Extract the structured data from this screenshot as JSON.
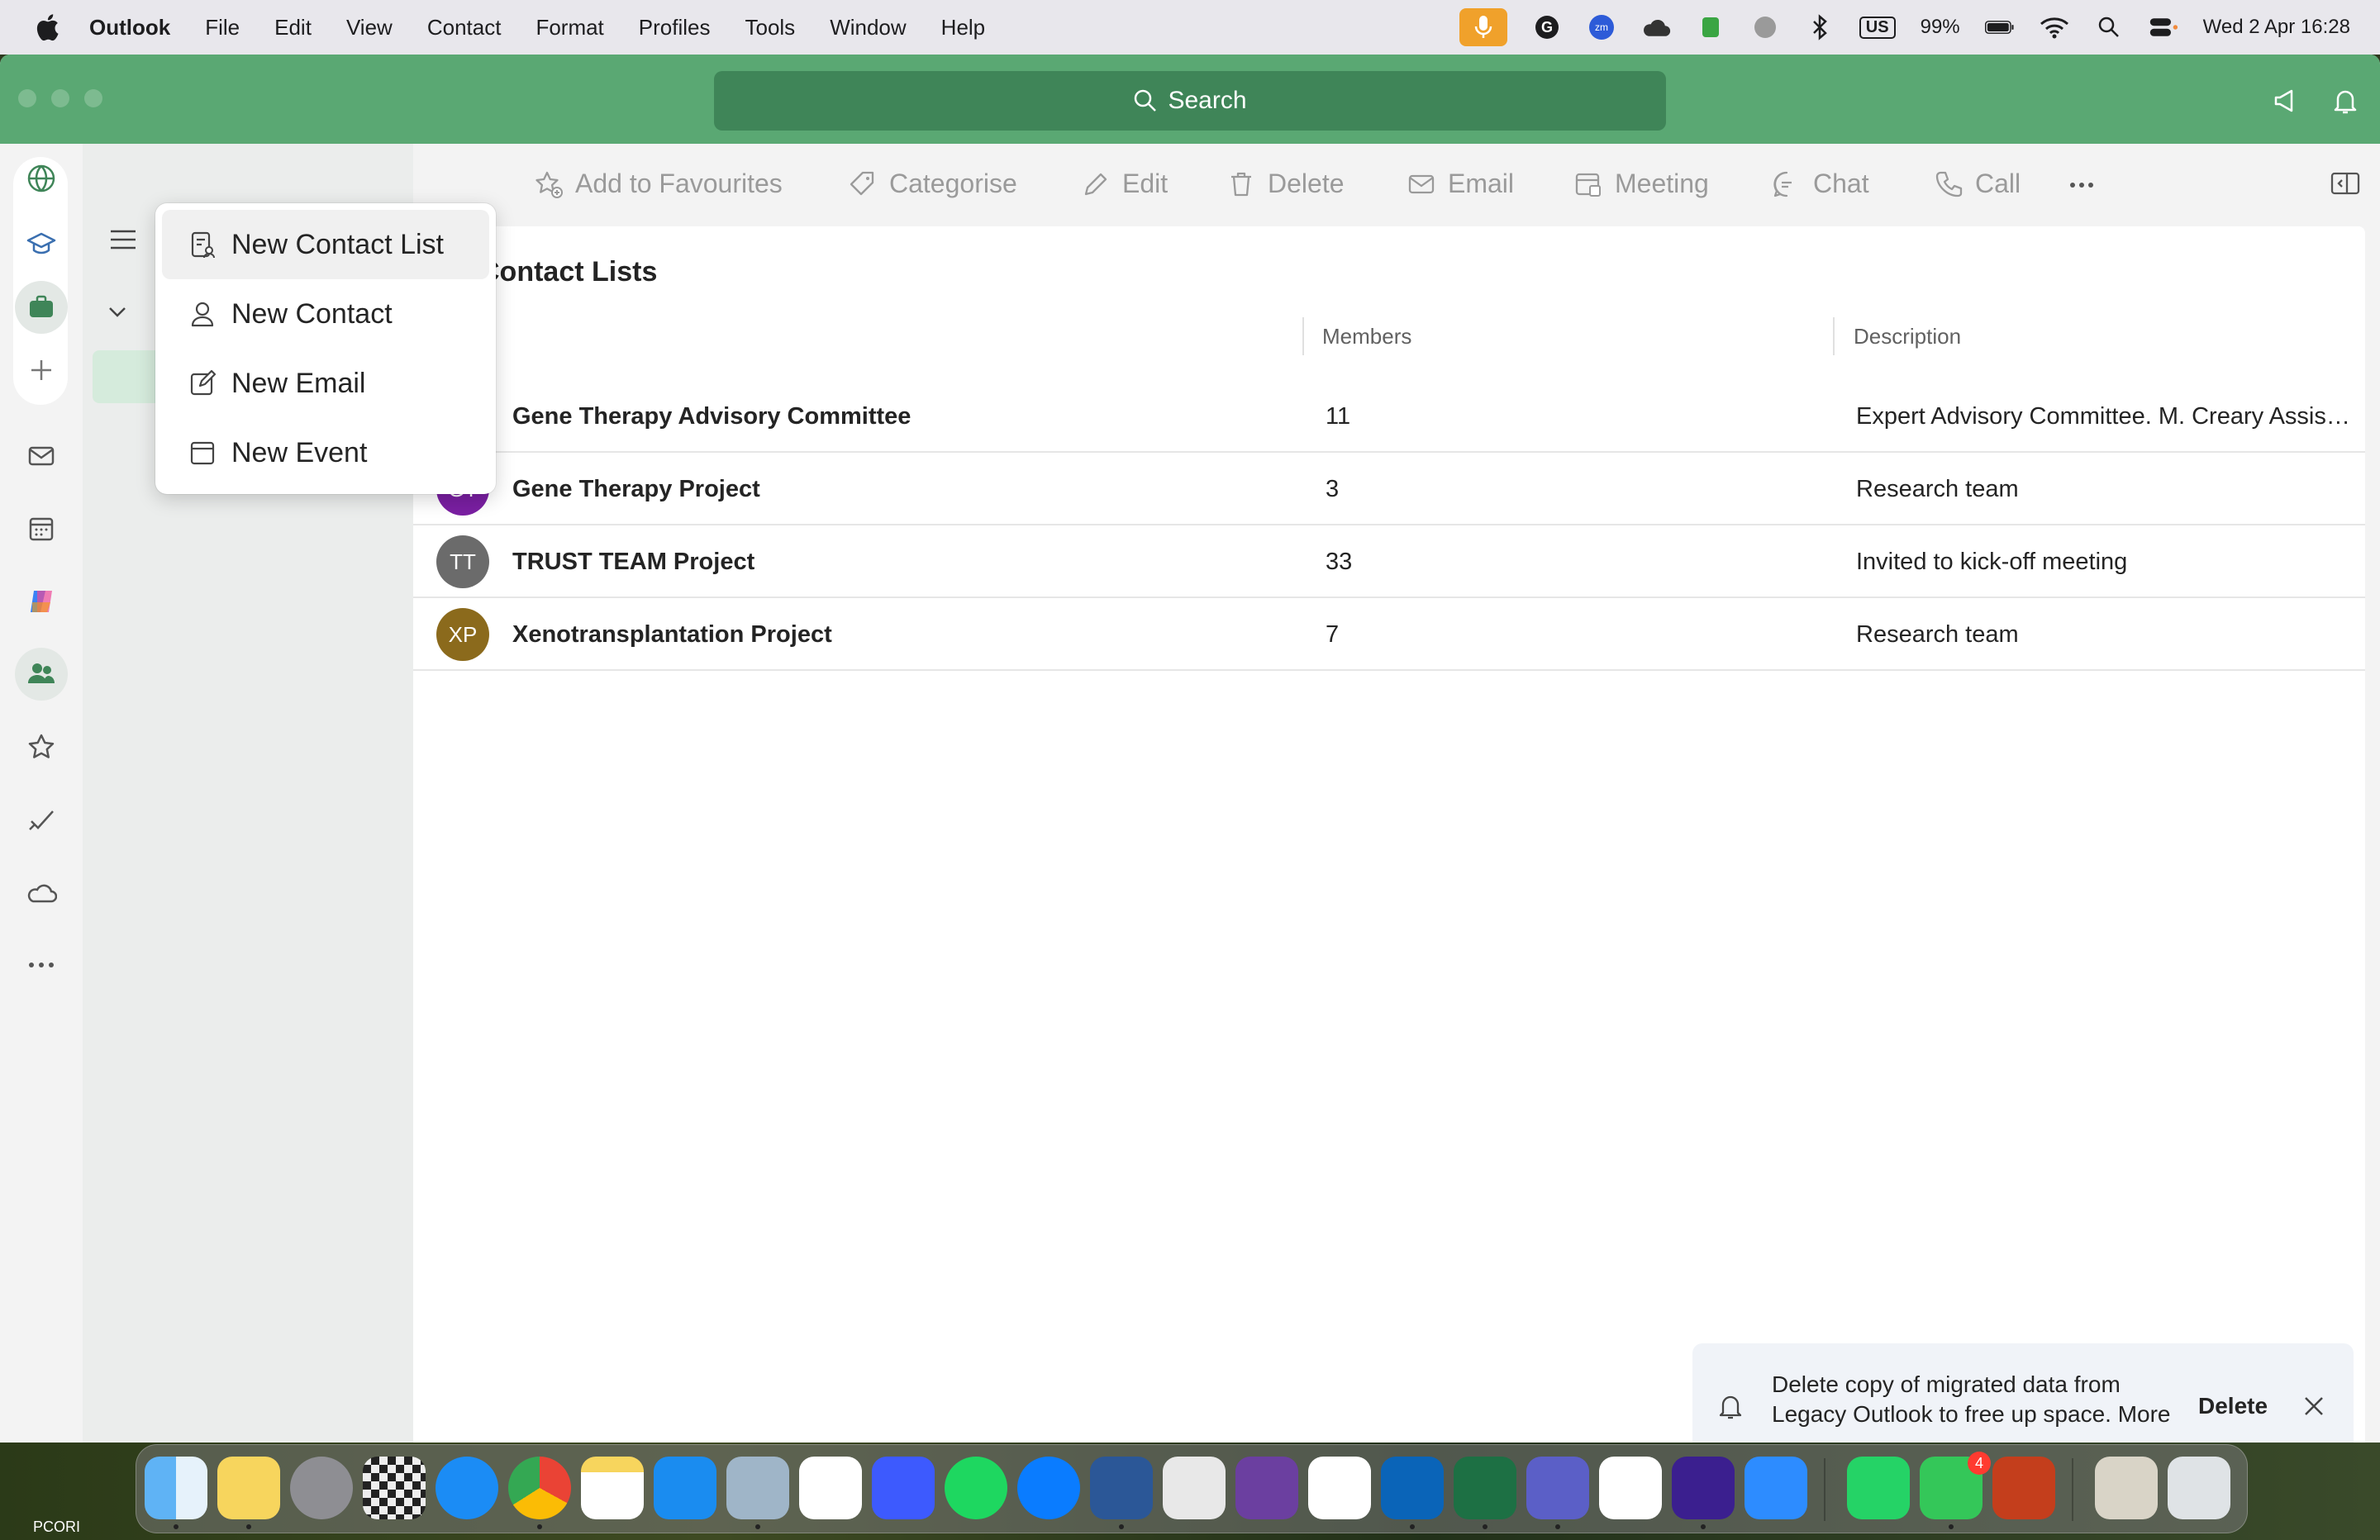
{
  "menubar": {
    "app_name": "Outlook",
    "items": [
      "File",
      "Edit",
      "View",
      "Contact",
      "Format",
      "Profiles",
      "Tools",
      "Window",
      "Help"
    ],
    "battery": "99%",
    "keyboard": "US",
    "datetime": "Wed 2 Apr  16:28"
  },
  "titlebar": {
    "search_label": "Search"
  },
  "toolbar": {
    "add_favourites": "Add to Favourites",
    "categorise": "Categorise",
    "edit": "Edit",
    "delete": "Delete",
    "email": "Email",
    "meeting": "Meeting",
    "chat": "Chat",
    "call": "Call"
  },
  "content": {
    "title": "Contact Lists",
    "columns": {
      "members": "Members",
      "description": "Description"
    },
    "rows": [
      {
        "initials": "",
        "name": "Gene Therapy Advisory Committee",
        "members": "11",
        "description": "Expert Advisory Committee.  M. Creary Assistant",
        "color": "#4a7c59"
      },
      {
        "initials": "GT",
        "name": "Gene Therapy Project",
        "members": "3",
        "description": "Research team",
        "color": "#7a1fa2"
      },
      {
        "initials": "TT",
        "name": "TRUST TEAM Project",
        "members": "33",
        "description": "Invited to kick-off meeting",
        "color": "#6b6b6b"
      },
      {
        "initials": "XP",
        "name": "Xenotransplantation Project",
        "members": "7",
        "description": "Research team",
        "color": "#8b6a1c"
      }
    ]
  },
  "dropdown": {
    "items": [
      {
        "label": "New Contact List",
        "icon": "contact-list-icon"
      },
      {
        "label": "New Contact",
        "icon": "person-icon"
      },
      {
        "label": "New Email",
        "icon": "compose-icon"
      },
      {
        "label": "New Event",
        "icon": "calendar-icon"
      }
    ]
  },
  "notice": {
    "line1": "Delete copy of migrated data from",
    "line2": "Legacy Outlook to free up space. More",
    "action": "Delete"
  },
  "wallpaper_label": "PCORI",
  "dock": {
    "messages_badge": "4"
  },
  "colors": {
    "titlebar": "#5aa873",
    "search": "#3f8558",
    "accent": "#5aa873"
  }
}
